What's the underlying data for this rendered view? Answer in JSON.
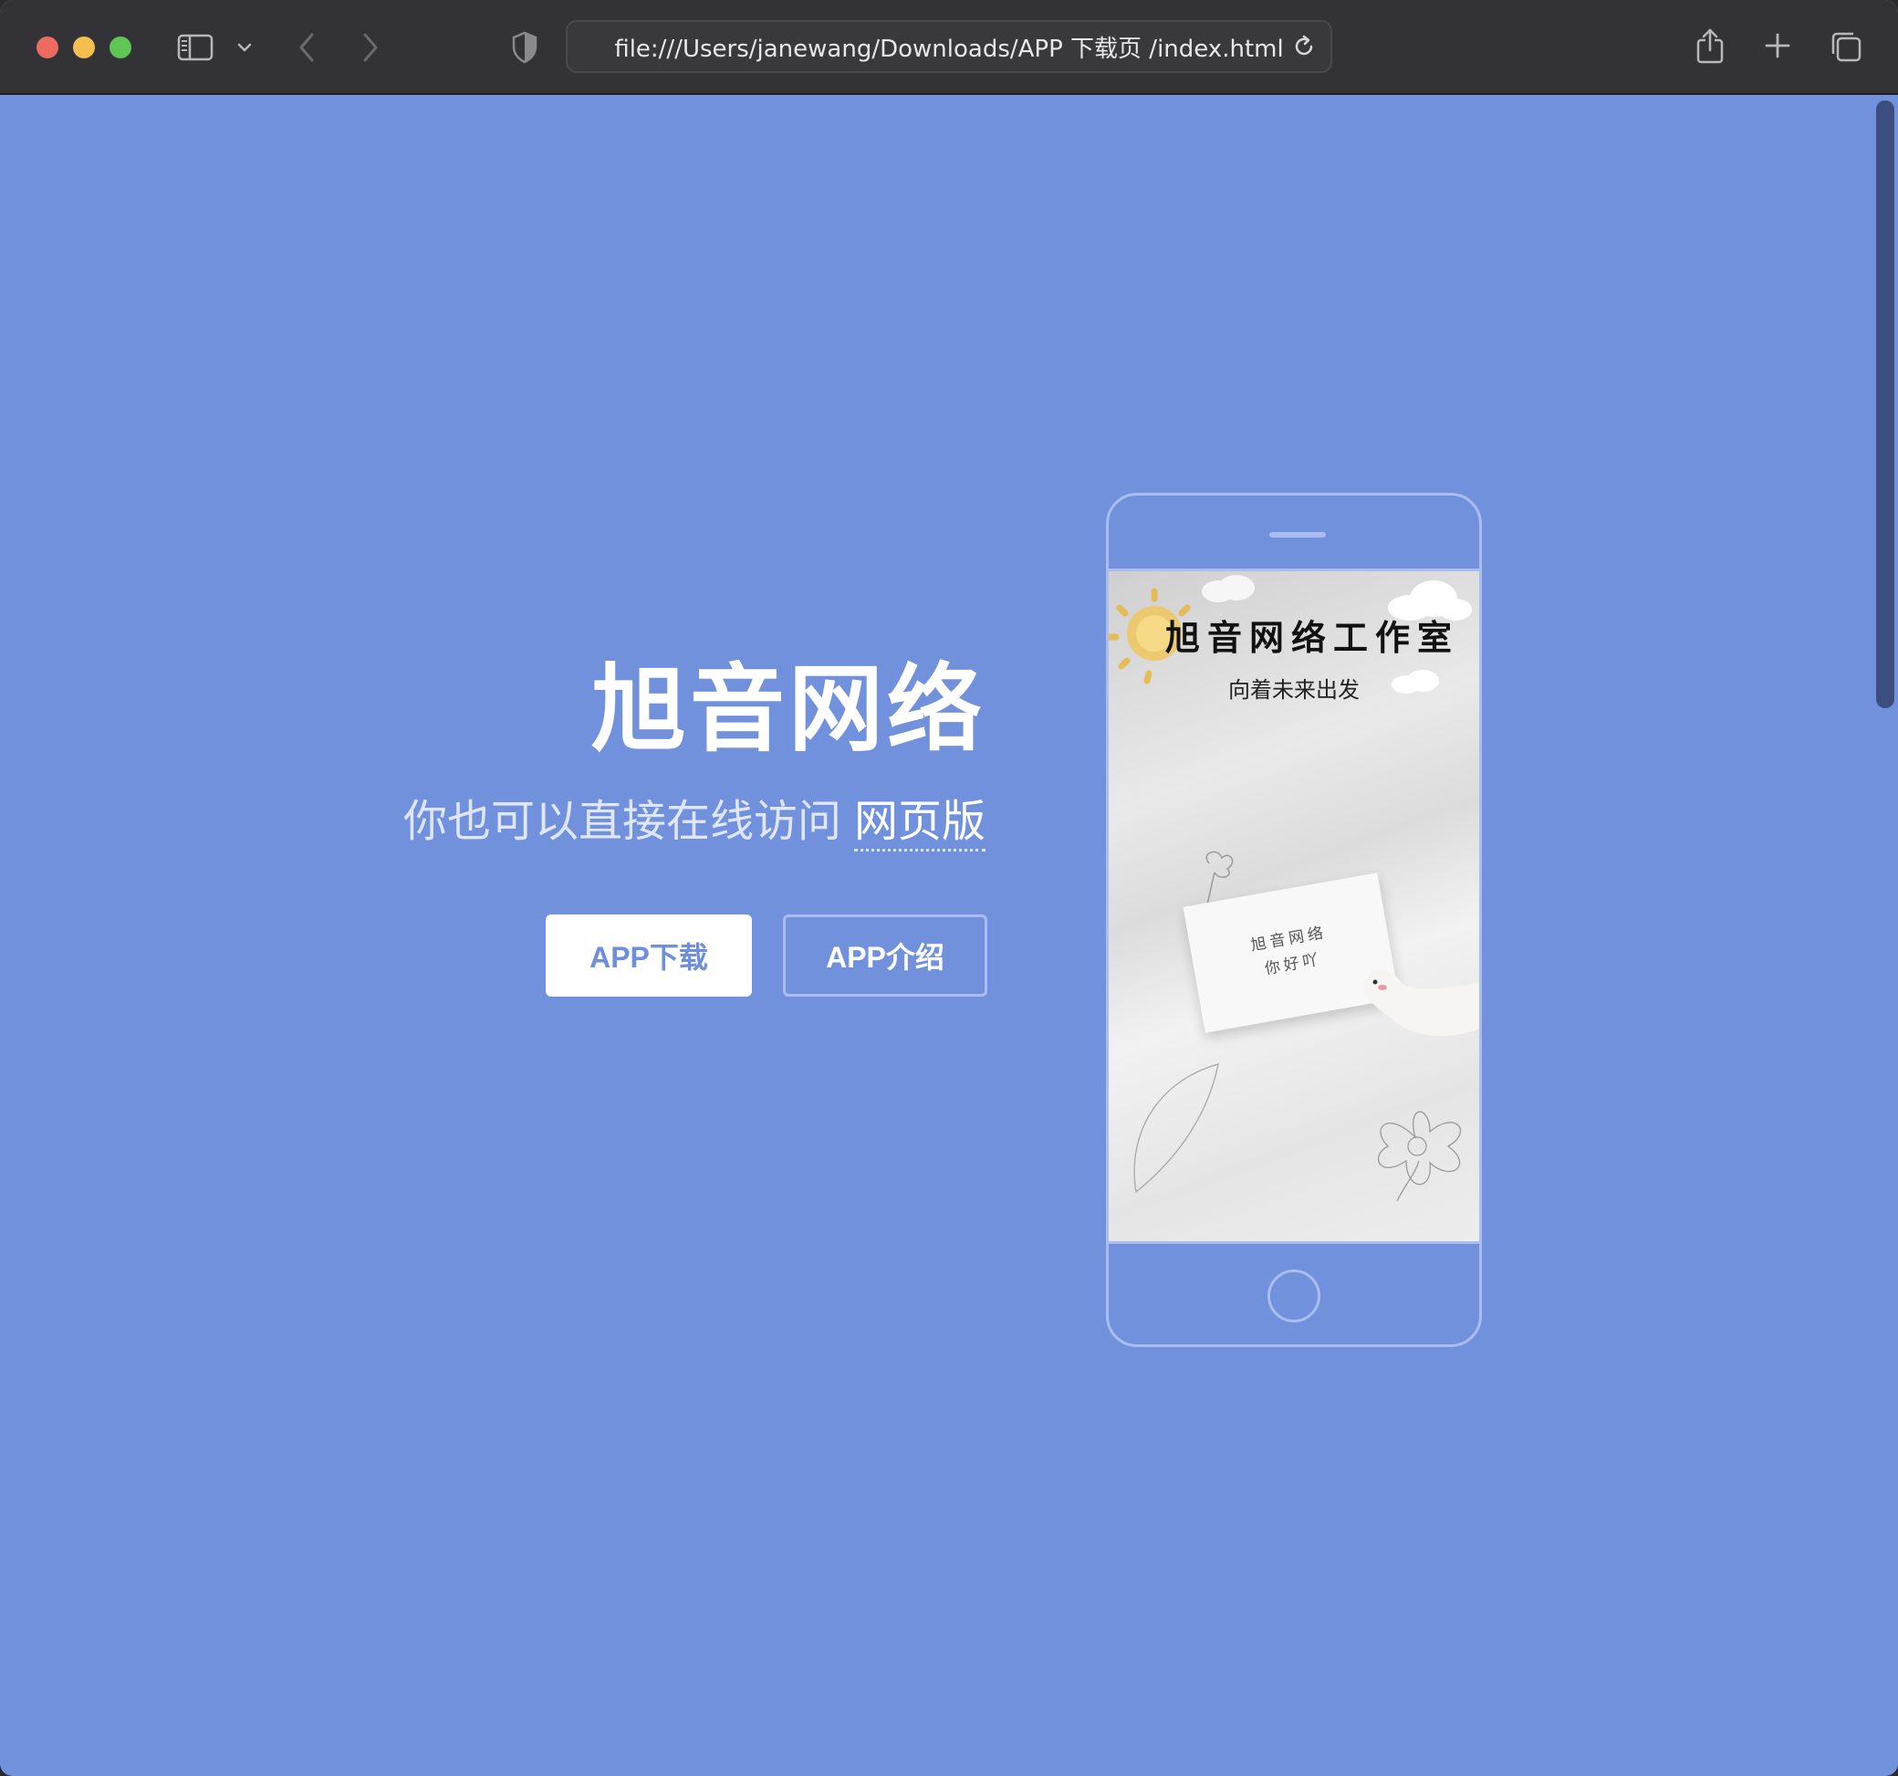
{
  "browser": {
    "url": "file:///Users/janewang/Downloads/APP 下载页 /index.html"
  },
  "hero": {
    "title": "旭音网络",
    "subtitle_prefix": "你也可以直接在线访问",
    "subtitle_link": "网页版",
    "download_button": "APP下载",
    "intro_button": "APP介绍"
  },
  "phone": {
    "screen_title": "旭音网络工作室",
    "screen_subtitle": "向着未来出发",
    "note_line1": "旭音网络",
    "note_line2": "你好吖"
  },
  "colors": {
    "page_background": "#7191dd",
    "toolbar_background": "#333236",
    "button_text": "#6f8fdb",
    "outline": "#a9bdee"
  },
  "icons": [
    "sidebar-icon",
    "chevron-down-icon",
    "back-icon",
    "forward-icon",
    "shield-icon",
    "reload-icon",
    "share-icon",
    "plus-icon",
    "tabs-icon"
  ]
}
